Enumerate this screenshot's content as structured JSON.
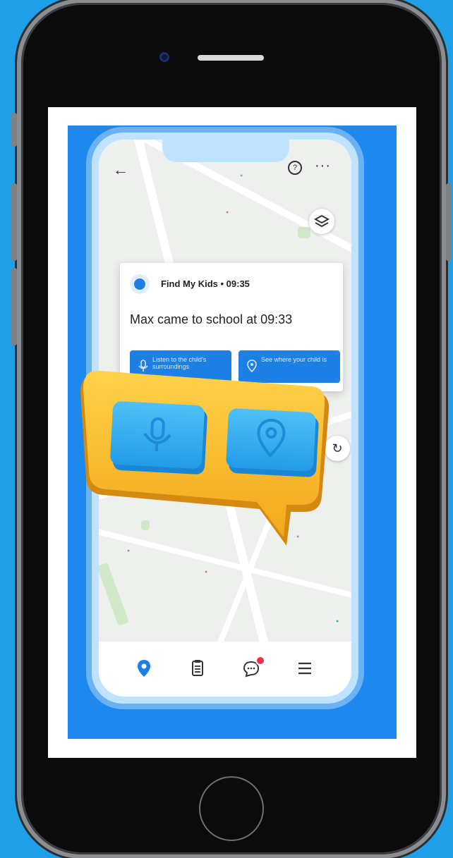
{
  "device": {
    "frame_color": "#0b0b0c",
    "background_color": "#1e9fe8",
    "accent_color": "#1d89ee"
  },
  "app": {
    "top_bar": {
      "back_icon": "arrow-left-icon",
      "help_icon": "question-circle-icon",
      "more_icon": "more-dots-icon"
    },
    "map_controls": {
      "layers_icon": "layers-icon",
      "refresh_icon": "refresh-icon"
    },
    "notification": {
      "title": "Find My Kids • 09:35",
      "message": "Max came to school at 09:33",
      "actions": [
        {
          "label": "Listen to the child's surroundings",
          "icon": "microphone-icon"
        },
        {
          "label": "See where your child is",
          "icon": "location-pin-icon"
        }
      ]
    },
    "tabbar": {
      "items": [
        {
          "name": "map",
          "icon": "location-pin-icon",
          "active": true
        },
        {
          "name": "history",
          "icon": "clipboard-icon",
          "active": false
        },
        {
          "name": "chat",
          "icon": "chat-bubble-icon",
          "badge": true
        },
        {
          "name": "menu",
          "icon": "hamburger-menu-icon",
          "active": false
        }
      ]
    },
    "illustration": {
      "type": "speech-bubble-3d",
      "bubble_color": "#f7b92a",
      "button_color": "#2aa6f0",
      "icons": [
        "microphone-icon",
        "location-pin-icon"
      ]
    }
  }
}
